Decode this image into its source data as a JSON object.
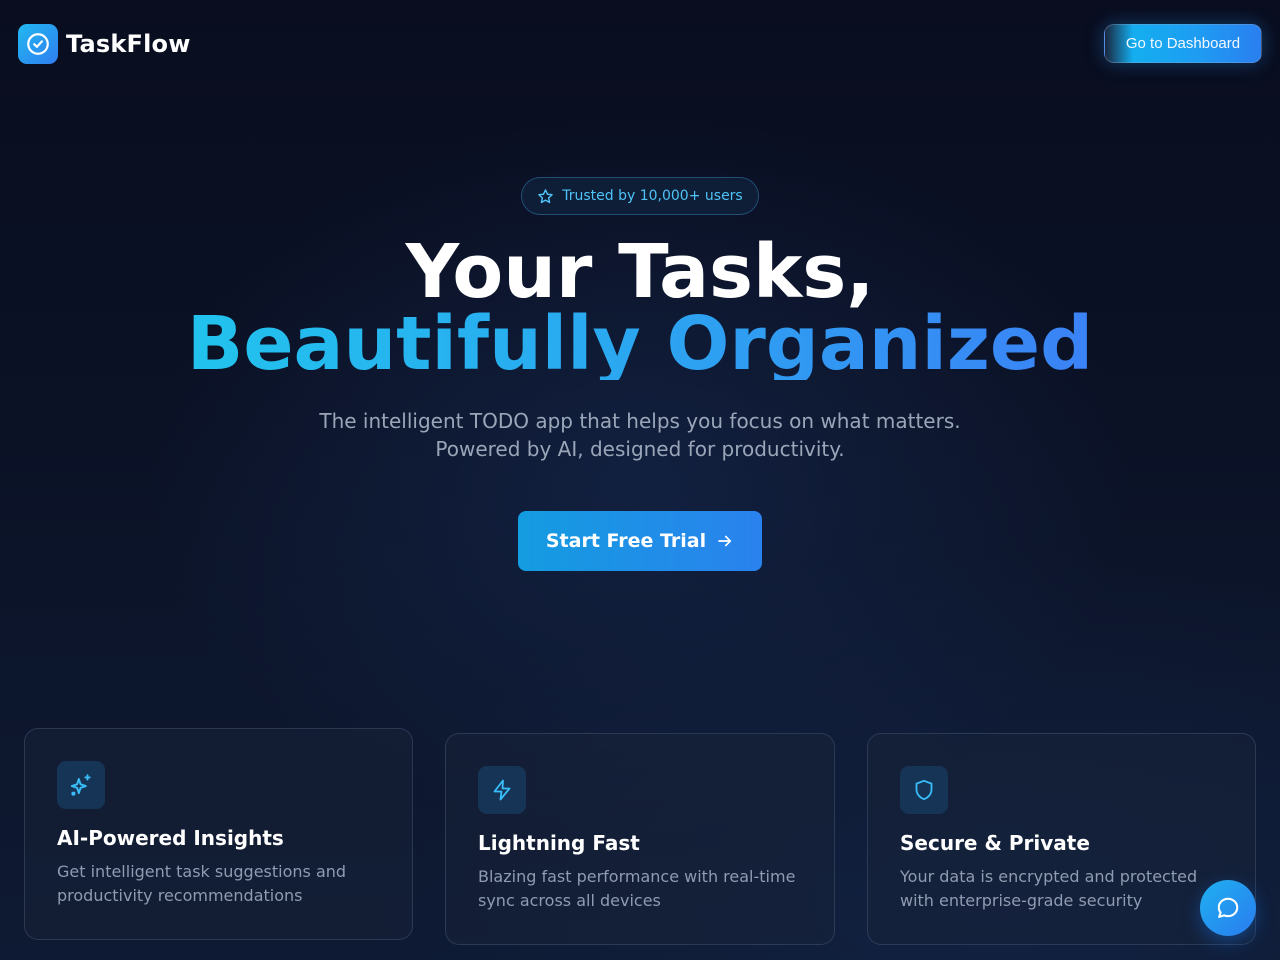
{
  "header": {
    "app_name": "TaskFlow",
    "logo_icon": "check-circle-icon",
    "dashboard_button": "Go to Dashboard"
  },
  "badge": {
    "icon": "star-icon",
    "text": "Trusted by 10,000+ users"
  },
  "hero": {
    "title_line1": "Your Tasks,",
    "title_line2": "Beautifully Organized",
    "subtitle_line1": "The intelligent TODO app that helps you focus on what matters.",
    "subtitle_line2": "Powered by AI, designed for productivity.",
    "cta_label": "Start Free Trial",
    "cta_icon": "arrow-right-icon"
  },
  "features": [
    {
      "icon": "sparkles-icon",
      "title": "AI-Powered Insights",
      "description": "Get intelligent task suggestions and productivity recommendations"
    },
    {
      "icon": "lightning-icon",
      "title": "Lightning Fast",
      "description": "Blazing fast performance with real-time sync across all devices"
    },
    {
      "icon": "shield-icon",
      "title": "Secure & Private",
      "description": "Your data is encrypted and protected with enterprise-grade security"
    }
  ],
  "chat": {
    "icon": "chat-bubble-icon"
  },
  "colors": {
    "accent_cyan": "#22c3ee",
    "accent_blue": "#3b82f6",
    "badge_text": "#4fc3f7",
    "muted_text": "#9aa6b8",
    "background": "#0b1226"
  }
}
